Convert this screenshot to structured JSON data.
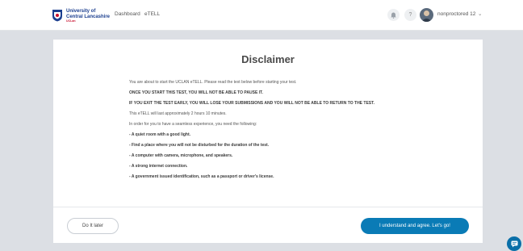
{
  "header": {
    "logo_line1": "University of",
    "logo_line2": "Central Lancashire",
    "logo_line3": "UCLan",
    "nav": [
      "Dashboard",
      "eTELL"
    ],
    "help_label": "?",
    "user_name": "nonproctored 12",
    "user_caret": "⌄"
  },
  "disclaimer": {
    "title": "Disclaimer",
    "lines": [
      "You are about to start the UCLAN eTELL. Please read the text below before starting your test.",
      "ONCE YOU START THIS TEST, YOU WILL NOT BE ABLE TO PAUSE IT.",
      "IF YOU EXIT THE TEST EARLY, YOU WILL LOSE YOUR SUBMISSIONS AND YOU WILL NOT BE ABLE TO RETURN TO THE TEST.",
      "This eTELL will last approximately 2 hours 10 minutes.",
      "In order for you to have a seamless experience, you need the following:",
      "- A quiet room with a good light.",
      "- Find a place where you will not be disturbed for the duration of the test.",
      "- A computer with camera, microphone, and speakers.",
      "- A strong internet connection.",
      "- A government issued identification, such as a passport or driver's license."
    ],
    "btn_later": "Do It later",
    "btn_agree": "I understand and agree. Let's go!"
  },
  "colors": {
    "accent": "#0a7bb6",
    "brand_blue": "#1c3f8f",
    "brand_red": "#c8102e"
  }
}
